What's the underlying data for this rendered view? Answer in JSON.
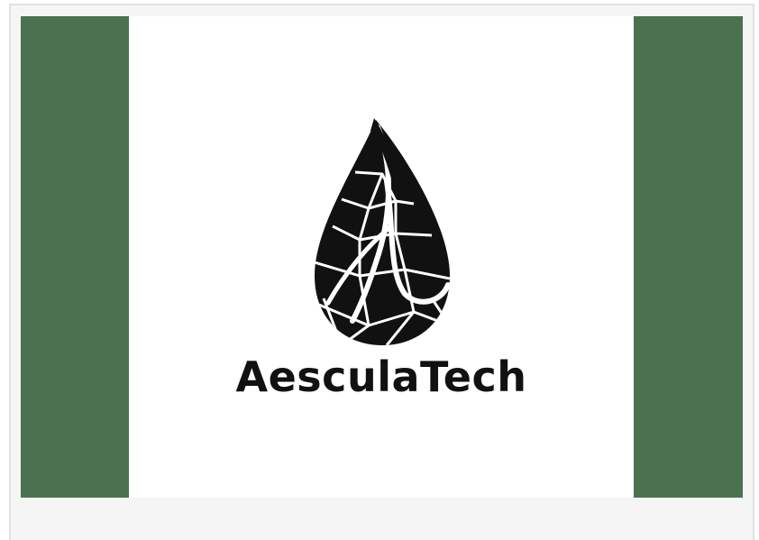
{
  "brand": {
    "name": "AesculaTech",
    "accent_color": "#4a7150",
    "logo_color": "#111111",
    "icon": "flame-drop-mosaic-icon"
  },
  "frame": {
    "background": "#f5f5f5",
    "border_color": "#e1e1e1"
  }
}
